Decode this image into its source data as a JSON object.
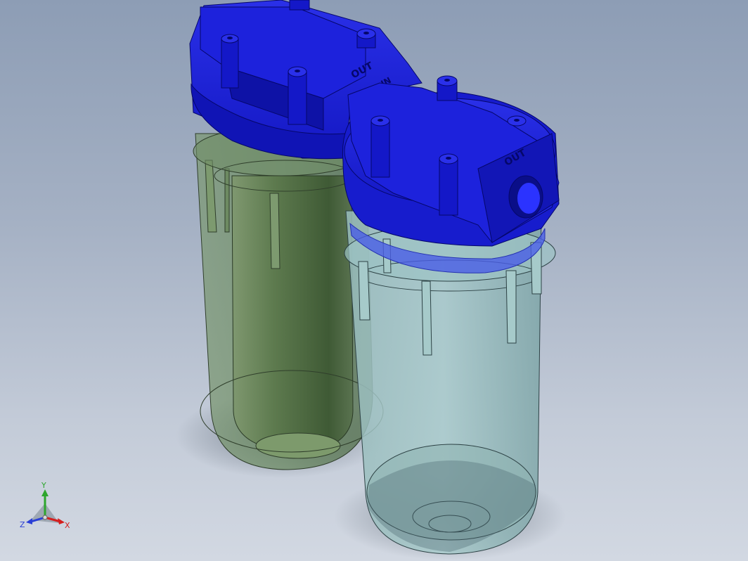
{
  "colors": {
    "background_top": "#8d9db5",
    "background_bottom": "#d2d8e2",
    "head_blue": "#1c22d6",
    "head_blue_dark": "#0c109a",
    "housing_green": "#5e7a4f",
    "housing_clear": "#8fb8b8",
    "axis_x": "#d41f1f",
    "axis_y": "#2da62d",
    "axis_z": "#2a3fd6"
  },
  "model": {
    "left_filter": {
      "outlet_label": "OUT",
      "inlet_label": "IN"
    },
    "right_filter": {
      "outlet_label": "OUT"
    }
  },
  "triad": {
    "x_label": "X",
    "y_label": "Y",
    "z_label": "Z"
  }
}
